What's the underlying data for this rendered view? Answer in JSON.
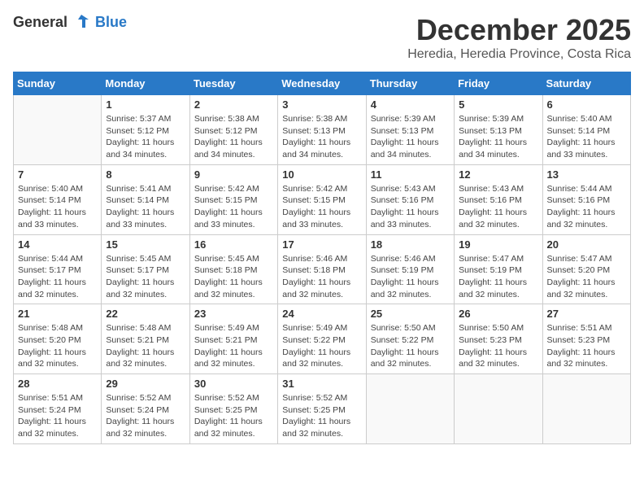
{
  "header": {
    "logo_general": "General",
    "logo_blue": "Blue",
    "month_title": "December 2025",
    "location": "Heredia, Heredia Province, Costa Rica"
  },
  "calendar": {
    "days_of_week": [
      "Sunday",
      "Monday",
      "Tuesday",
      "Wednesday",
      "Thursday",
      "Friday",
      "Saturday"
    ],
    "weeks": [
      [
        {
          "day": "",
          "sunrise": "",
          "sunset": "",
          "daylight": ""
        },
        {
          "day": "1",
          "sunrise": "Sunrise: 5:37 AM",
          "sunset": "Sunset: 5:12 PM",
          "daylight": "Daylight: 11 hours and 34 minutes."
        },
        {
          "day": "2",
          "sunrise": "Sunrise: 5:38 AM",
          "sunset": "Sunset: 5:12 PM",
          "daylight": "Daylight: 11 hours and 34 minutes."
        },
        {
          "day": "3",
          "sunrise": "Sunrise: 5:38 AM",
          "sunset": "Sunset: 5:13 PM",
          "daylight": "Daylight: 11 hours and 34 minutes."
        },
        {
          "day": "4",
          "sunrise": "Sunrise: 5:39 AM",
          "sunset": "Sunset: 5:13 PM",
          "daylight": "Daylight: 11 hours and 34 minutes."
        },
        {
          "day": "5",
          "sunrise": "Sunrise: 5:39 AM",
          "sunset": "Sunset: 5:13 PM",
          "daylight": "Daylight: 11 hours and 34 minutes."
        },
        {
          "day": "6",
          "sunrise": "Sunrise: 5:40 AM",
          "sunset": "Sunset: 5:14 PM",
          "daylight": "Daylight: 11 hours and 33 minutes."
        }
      ],
      [
        {
          "day": "7",
          "sunrise": "Sunrise: 5:40 AM",
          "sunset": "Sunset: 5:14 PM",
          "daylight": "Daylight: 11 hours and 33 minutes."
        },
        {
          "day": "8",
          "sunrise": "Sunrise: 5:41 AM",
          "sunset": "Sunset: 5:14 PM",
          "daylight": "Daylight: 11 hours and 33 minutes."
        },
        {
          "day": "9",
          "sunrise": "Sunrise: 5:42 AM",
          "sunset": "Sunset: 5:15 PM",
          "daylight": "Daylight: 11 hours and 33 minutes."
        },
        {
          "day": "10",
          "sunrise": "Sunrise: 5:42 AM",
          "sunset": "Sunset: 5:15 PM",
          "daylight": "Daylight: 11 hours and 33 minutes."
        },
        {
          "day": "11",
          "sunrise": "Sunrise: 5:43 AM",
          "sunset": "Sunset: 5:16 PM",
          "daylight": "Daylight: 11 hours and 33 minutes."
        },
        {
          "day": "12",
          "sunrise": "Sunrise: 5:43 AM",
          "sunset": "Sunset: 5:16 PM",
          "daylight": "Daylight: 11 hours and 32 minutes."
        },
        {
          "day": "13",
          "sunrise": "Sunrise: 5:44 AM",
          "sunset": "Sunset: 5:16 PM",
          "daylight": "Daylight: 11 hours and 32 minutes."
        }
      ],
      [
        {
          "day": "14",
          "sunrise": "Sunrise: 5:44 AM",
          "sunset": "Sunset: 5:17 PM",
          "daylight": "Daylight: 11 hours and 32 minutes."
        },
        {
          "day": "15",
          "sunrise": "Sunrise: 5:45 AM",
          "sunset": "Sunset: 5:17 PM",
          "daylight": "Daylight: 11 hours and 32 minutes."
        },
        {
          "day": "16",
          "sunrise": "Sunrise: 5:45 AM",
          "sunset": "Sunset: 5:18 PM",
          "daylight": "Daylight: 11 hours and 32 minutes."
        },
        {
          "day": "17",
          "sunrise": "Sunrise: 5:46 AM",
          "sunset": "Sunset: 5:18 PM",
          "daylight": "Daylight: 11 hours and 32 minutes."
        },
        {
          "day": "18",
          "sunrise": "Sunrise: 5:46 AM",
          "sunset": "Sunset: 5:19 PM",
          "daylight": "Daylight: 11 hours and 32 minutes."
        },
        {
          "day": "19",
          "sunrise": "Sunrise: 5:47 AM",
          "sunset": "Sunset: 5:19 PM",
          "daylight": "Daylight: 11 hours and 32 minutes."
        },
        {
          "day": "20",
          "sunrise": "Sunrise: 5:47 AM",
          "sunset": "Sunset: 5:20 PM",
          "daylight": "Daylight: 11 hours and 32 minutes."
        }
      ],
      [
        {
          "day": "21",
          "sunrise": "Sunrise: 5:48 AM",
          "sunset": "Sunset: 5:20 PM",
          "daylight": "Daylight: 11 hours and 32 minutes."
        },
        {
          "day": "22",
          "sunrise": "Sunrise: 5:48 AM",
          "sunset": "Sunset: 5:21 PM",
          "daylight": "Daylight: 11 hours and 32 minutes."
        },
        {
          "day": "23",
          "sunrise": "Sunrise: 5:49 AM",
          "sunset": "Sunset: 5:21 PM",
          "daylight": "Daylight: 11 hours and 32 minutes."
        },
        {
          "day": "24",
          "sunrise": "Sunrise: 5:49 AM",
          "sunset": "Sunset: 5:22 PM",
          "daylight": "Daylight: 11 hours and 32 minutes."
        },
        {
          "day": "25",
          "sunrise": "Sunrise: 5:50 AM",
          "sunset": "Sunset: 5:22 PM",
          "daylight": "Daylight: 11 hours and 32 minutes."
        },
        {
          "day": "26",
          "sunrise": "Sunrise: 5:50 AM",
          "sunset": "Sunset: 5:23 PM",
          "daylight": "Daylight: 11 hours and 32 minutes."
        },
        {
          "day": "27",
          "sunrise": "Sunrise: 5:51 AM",
          "sunset": "Sunset: 5:23 PM",
          "daylight": "Daylight: 11 hours and 32 minutes."
        }
      ],
      [
        {
          "day": "28",
          "sunrise": "Sunrise: 5:51 AM",
          "sunset": "Sunset: 5:24 PM",
          "daylight": "Daylight: 11 hours and 32 minutes."
        },
        {
          "day": "29",
          "sunrise": "Sunrise: 5:52 AM",
          "sunset": "Sunset: 5:24 PM",
          "daylight": "Daylight: 11 hours and 32 minutes."
        },
        {
          "day": "30",
          "sunrise": "Sunrise: 5:52 AM",
          "sunset": "Sunset: 5:25 PM",
          "daylight": "Daylight: 11 hours and 32 minutes."
        },
        {
          "day": "31",
          "sunrise": "Sunrise: 5:52 AM",
          "sunset": "Sunset: 5:25 PM",
          "daylight": "Daylight: 11 hours and 32 minutes."
        },
        {
          "day": "",
          "sunrise": "",
          "sunset": "",
          "daylight": ""
        },
        {
          "day": "",
          "sunrise": "",
          "sunset": "",
          "daylight": ""
        },
        {
          "day": "",
          "sunrise": "",
          "sunset": "",
          "daylight": ""
        }
      ]
    ]
  }
}
